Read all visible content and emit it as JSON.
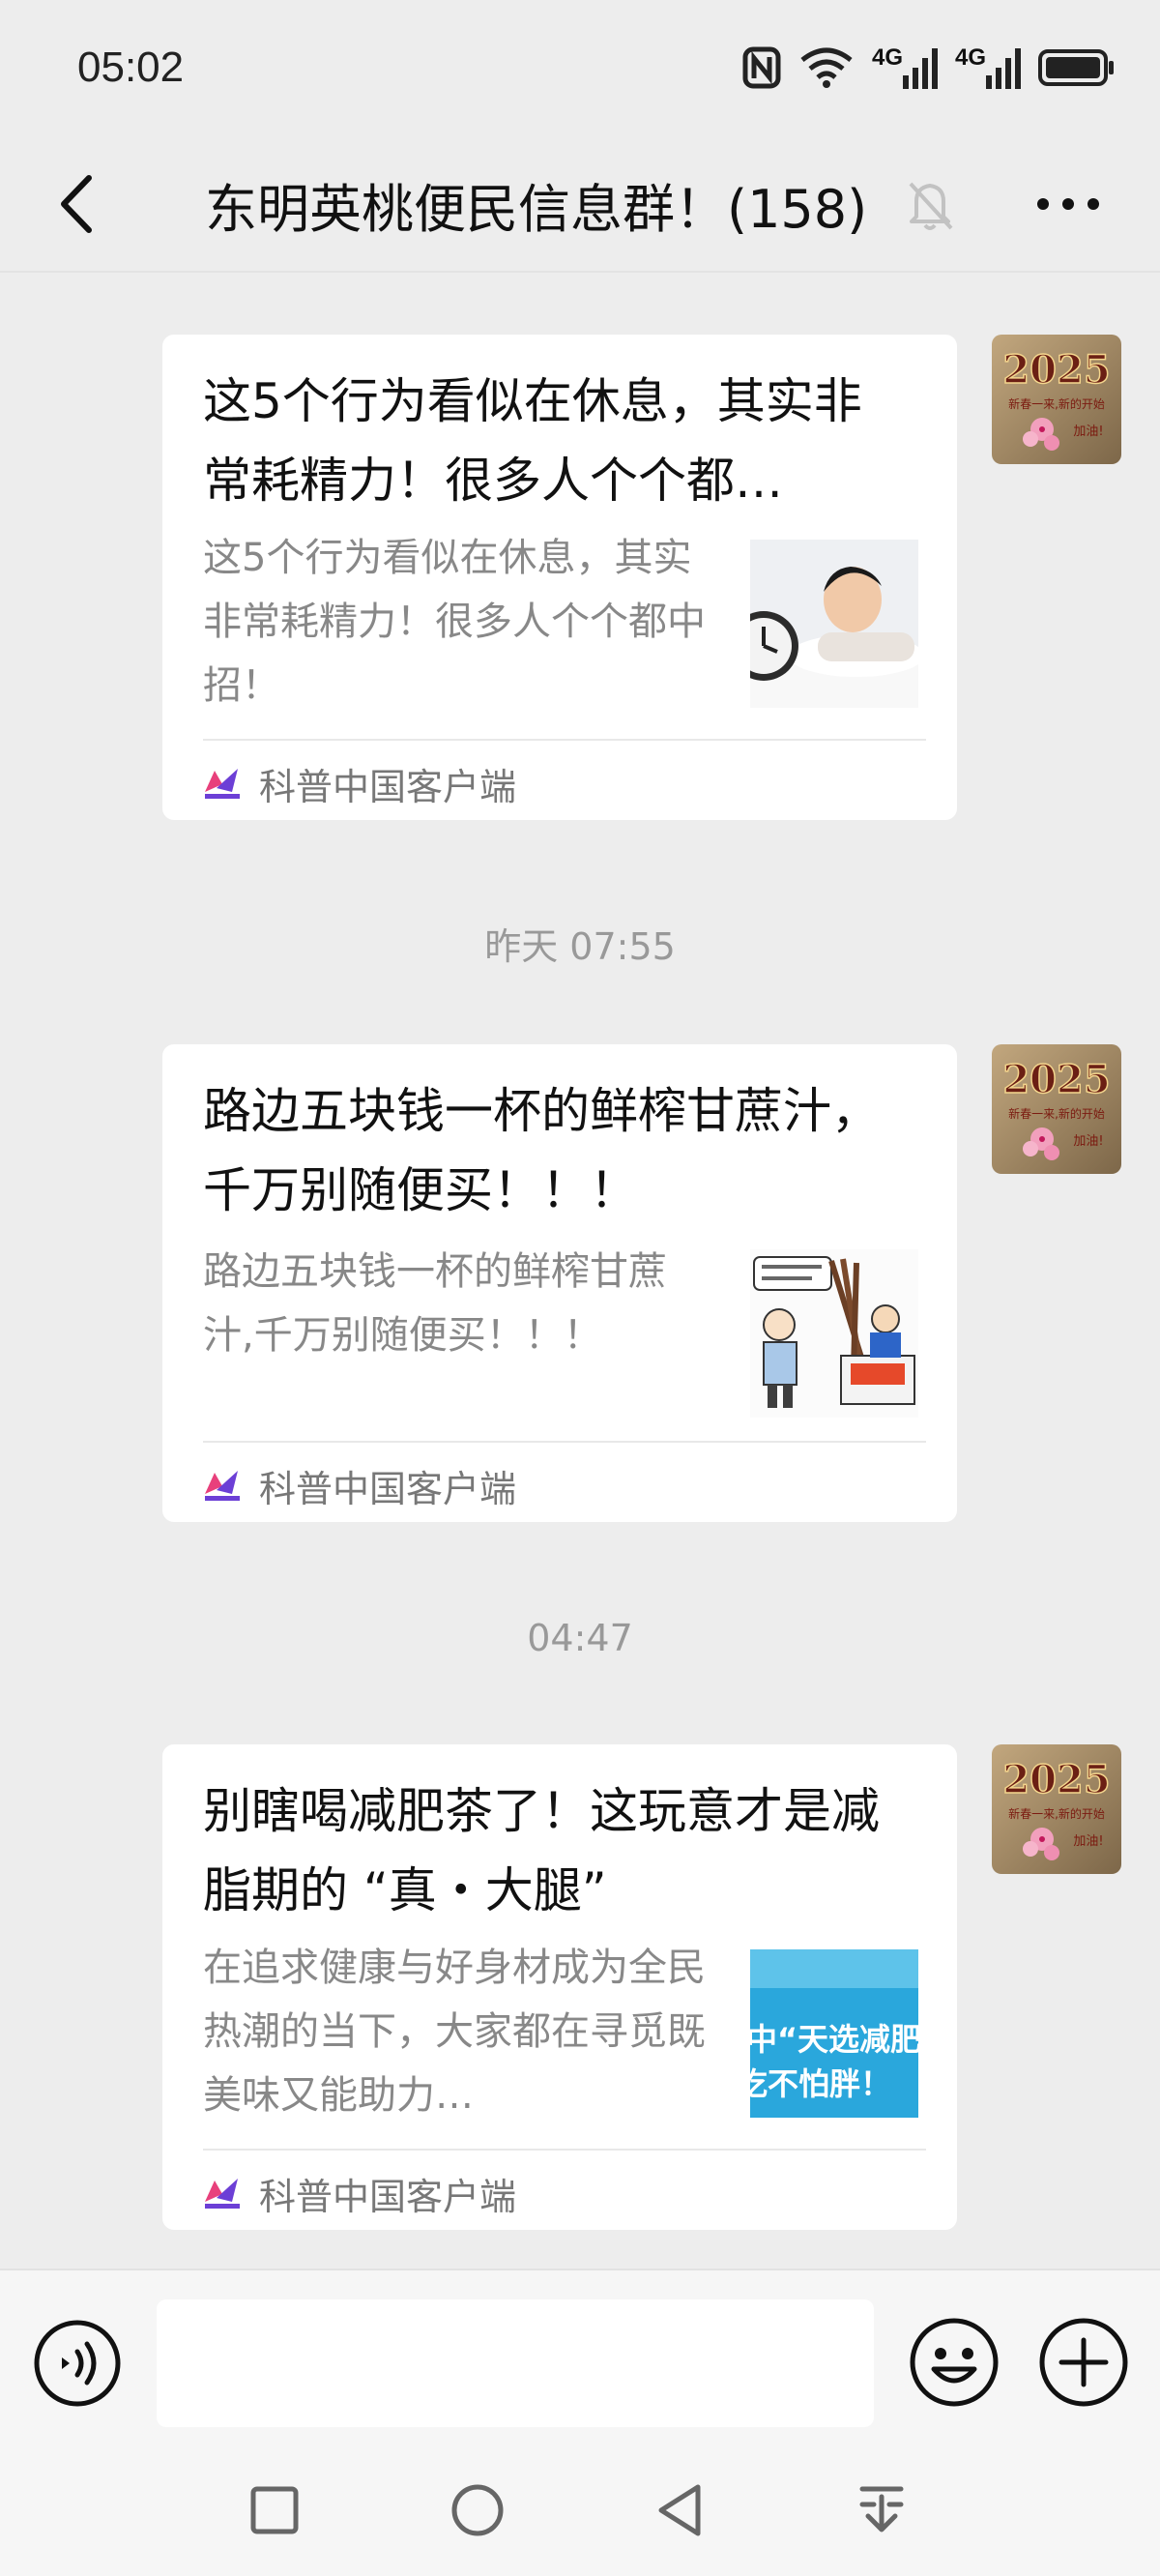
{
  "status_bar": {
    "time": "05:02",
    "net_1": "4G",
    "net_2": "4G",
    "icons": [
      "nfc-icon",
      "wifi-icon",
      "signal-icon",
      "signal-icon",
      "battery-icon"
    ]
  },
  "nav": {
    "title": "东明英桃便民信息群！(158)",
    "icons": [
      "back-icon",
      "mute-bell-icon",
      "more-icon"
    ]
  },
  "messages": [
    {
      "title": "这5个行为看似在休息，其实非常耗精力！很多人个个都…",
      "desc": "这5个行为看似在休息，其实非常耗精力！很多人个个都中招！",
      "source": "科普中国客户端",
      "thumb": "sleeping-man-with-alarm-clock"
    },
    {
      "title": "路边五块钱一杯的鲜榨甘蔗汁，千万别随便买！！！",
      "desc": "路边五块钱一杯的鲜榨甘蔗汁,千万别随便买！！！",
      "source": "科普中国客户端",
      "thumb": "sugarcane-juice-cartoon"
    },
    {
      "title": "别瞎喝减肥茶了！这玩意才是减脂期的 “真・大腿”",
      "desc": "在追求健康与好身材成为全民热潮的当下，大家都在寻觅既美味又能助力…",
      "source": "科普中国客户端",
      "thumb": "weight-loss-banner"
    }
  ],
  "thumb_text": {
    "line_1": "中“天选减肥",
    "line_2": "吃不怕胖！"
  },
  "avatar": {
    "year": "2025",
    "line": "新春一来,新的开始",
    "sub": "加油!"
  },
  "timestamps": [
    "昨天 07:55",
    "04:47"
  ],
  "input": {
    "value": "",
    "placeholder": ""
  },
  "colors": {
    "background": "#ededed",
    "card": "#ffffff",
    "source_logo_pink": "#e8407c",
    "source_logo_purple": "#6c3fd6",
    "thumb_blue": "#2aa7dc"
  }
}
